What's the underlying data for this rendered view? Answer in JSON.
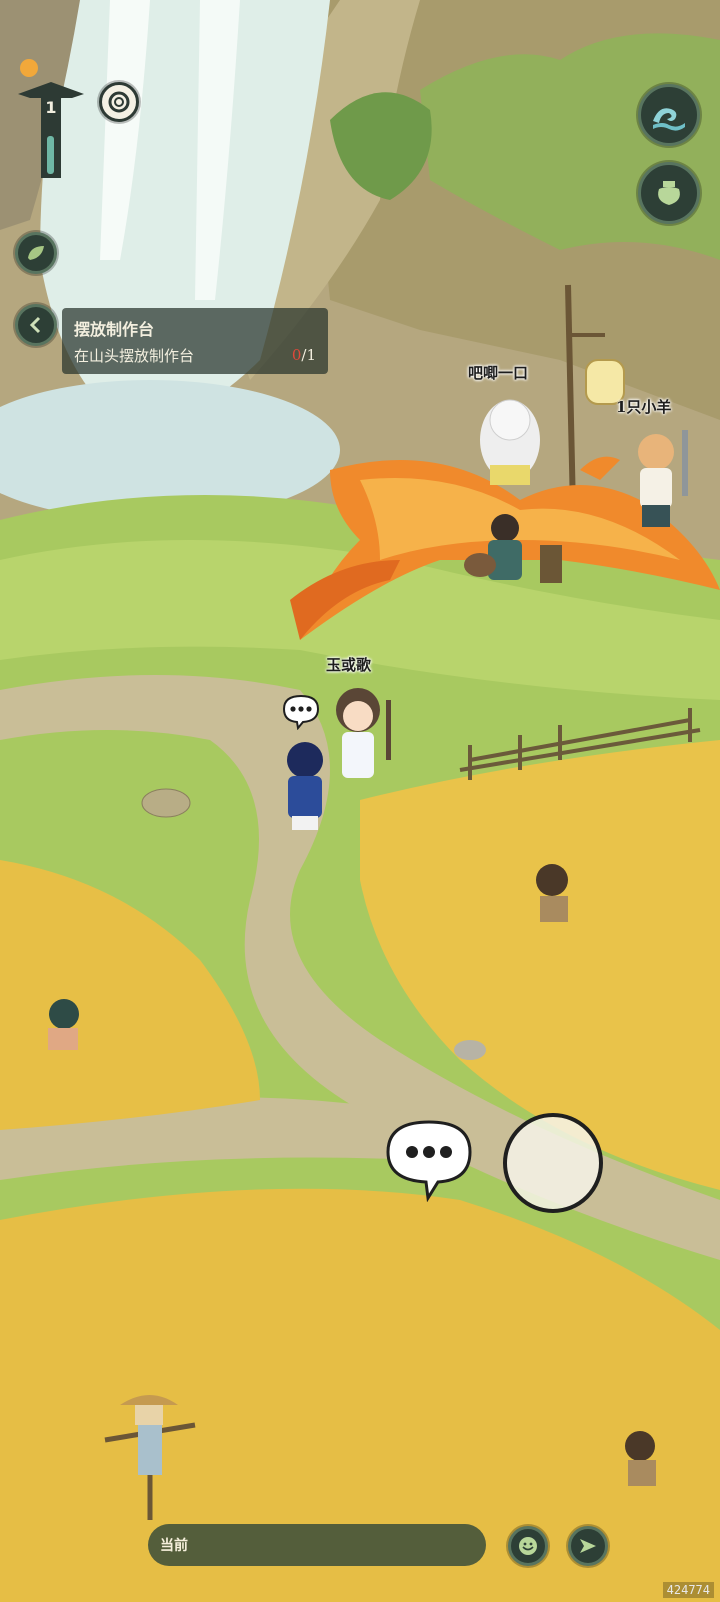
{
  "hud": {
    "level": "1",
    "quest": {
      "title": "摆放制作台",
      "description": "在山头摆放制作台",
      "progress_current": "0",
      "progress_total": "/1"
    }
  },
  "characters": {
    "npc_top": "吧唧一口",
    "npc_sheep": "1只小羊",
    "player": "玉或歌"
  },
  "chat": {
    "channel_label": "当前"
  },
  "icons": {
    "wave": "wave-icon",
    "pot": "pot-icon",
    "leaf": "leaf-icon",
    "back": "chevron-left-icon",
    "ring": "ring-icon",
    "speech": "speech-bubble-icon",
    "emoji": "smile-icon",
    "send": "send-icon"
  },
  "watermark": "424774"
}
